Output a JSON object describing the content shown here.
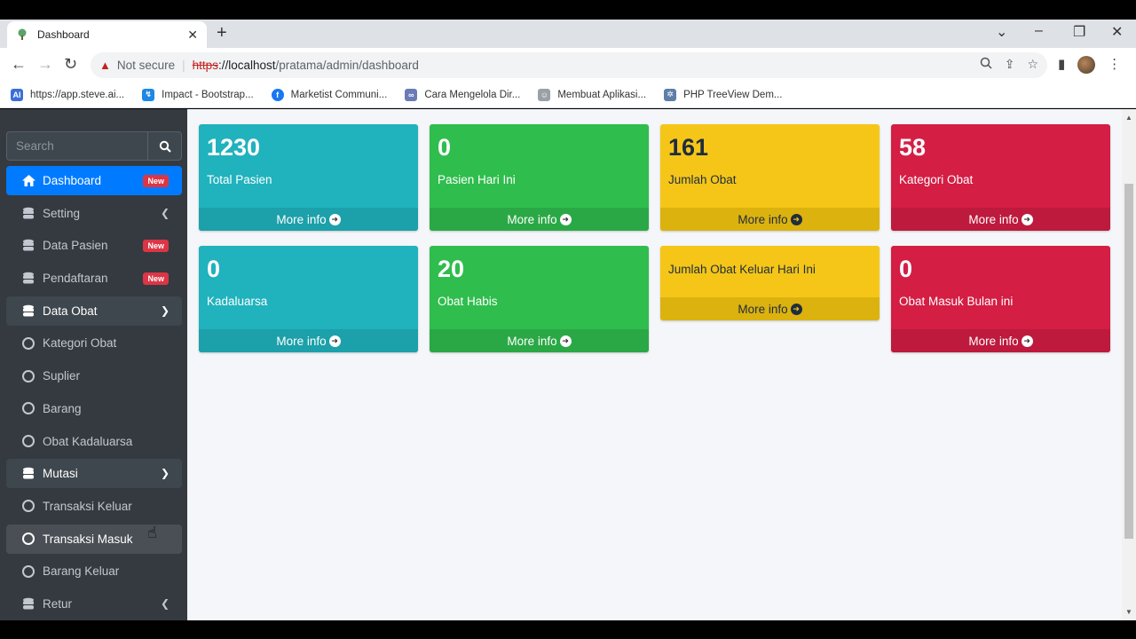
{
  "browser": {
    "tab_title": "Dashboard",
    "tab_close": "✕",
    "new_tab": "+",
    "url_warning": "Not secure",
    "url_scheme": "https",
    "url_host": "://localhost",
    "url_path": "/pratama/admin/dashboard",
    "bookmarks": [
      {
        "label": "https://app.steve.ai...",
        "icon": "ai-icon",
        "color": "#3b6fd8"
      },
      {
        "label": "Impact - Bootstrap...",
        "icon": "impact-icon",
        "color": "#1e88e5"
      },
      {
        "label": "Marketist Communi...",
        "icon": "facebook-icon",
        "color": "#1877f2"
      },
      {
        "label": "Cara Mengelola Dir...",
        "icon": "link-icon",
        "color": "#6a7bb5"
      },
      {
        "label": "Membuat Aplikasi...",
        "icon": "person-icon",
        "color": "#9aa0a6"
      },
      {
        "label": "PHP TreeView Dem...",
        "icon": "gear-icon",
        "color": "#5f7ea8"
      }
    ]
  },
  "sidebar": {
    "search_placeholder": "Search",
    "items": [
      {
        "label": "Dashboard",
        "badge": "New"
      },
      {
        "label": "Setting"
      },
      {
        "label": "Data Pasien",
        "badge": "New"
      },
      {
        "label": "Pendaftaran",
        "badge": "New"
      },
      {
        "label": "Data Obat"
      },
      {
        "label": "Kategori Obat"
      },
      {
        "label": "Suplier"
      },
      {
        "label": "Barang"
      },
      {
        "label": "Obat Kadaluarsa"
      },
      {
        "label": "Mutasi"
      },
      {
        "label": "Transaksi Keluar"
      },
      {
        "label": "Transaksi Masuk"
      },
      {
        "label": "Barang Keluar"
      },
      {
        "label": "Retur"
      }
    ]
  },
  "boxes": [
    {
      "value": "1230",
      "label": "Total Pasien",
      "footer": "More info",
      "color": "#20b2bd"
    },
    {
      "value": "0",
      "label": "Pasien Hari Ini",
      "footer": "More info",
      "color": "#2fbd4d"
    },
    {
      "value": "161",
      "label": "Jumlah Obat",
      "footer": "More info",
      "color": "#f5c618"
    },
    {
      "value": "58",
      "label": "Kategori Obat",
      "footer": "More info",
      "color": "#d41e44"
    },
    {
      "value": "0",
      "label": "Kadaluarsa",
      "footer": "More info",
      "color": "#20b2bd"
    },
    {
      "value": "20",
      "label": "Obat Habis",
      "footer": "More info",
      "color": "#2fbd4d"
    },
    {
      "value": "",
      "label": "Jumlah Obat Keluar Hari Ini",
      "footer": "More info",
      "color": "#f5c618"
    },
    {
      "value": "0",
      "label": "Obat Masuk Bulan ini",
      "footer": "More info",
      "color": "#d41e44"
    }
  ]
}
